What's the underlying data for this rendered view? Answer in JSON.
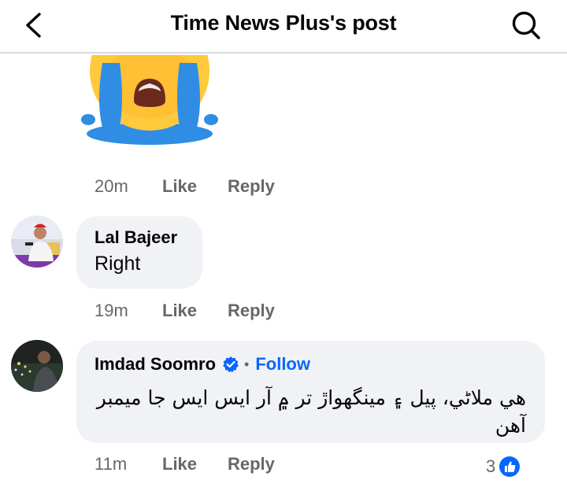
{
  "header": {
    "title": "Time News Plus's post",
    "back_icon": "chevron-left-icon",
    "search_icon": "search-icon"
  },
  "sticker": {
    "icon": "crying-face-sticker"
  },
  "comments": [
    {
      "time": "20m",
      "like_label": "Like",
      "reply_label": "Reply"
    },
    {
      "author": "Lal Bajeer",
      "text": "Right",
      "time": "19m",
      "like_label": "Like",
      "reply_label": "Reply"
    },
    {
      "author": "Imdad Soomro",
      "verified": true,
      "follow_label": "Follow",
      "text": "هي ملاڻي، پيل ۽ مينگهواڙ تر ۾ آر ايس ايس جا ميمبر آهن",
      "time": "11m",
      "like_label": "Like",
      "reply_label": "Reply",
      "reaction_count": "3",
      "reaction_icon": "like-reaction-icon"
    }
  ],
  "colors": {
    "accent": "#0866ff",
    "bubble": "#f0f2f5",
    "meta": "#65676b",
    "sticker_face": "#ffc93c",
    "sticker_tears": "#2f8de4"
  }
}
